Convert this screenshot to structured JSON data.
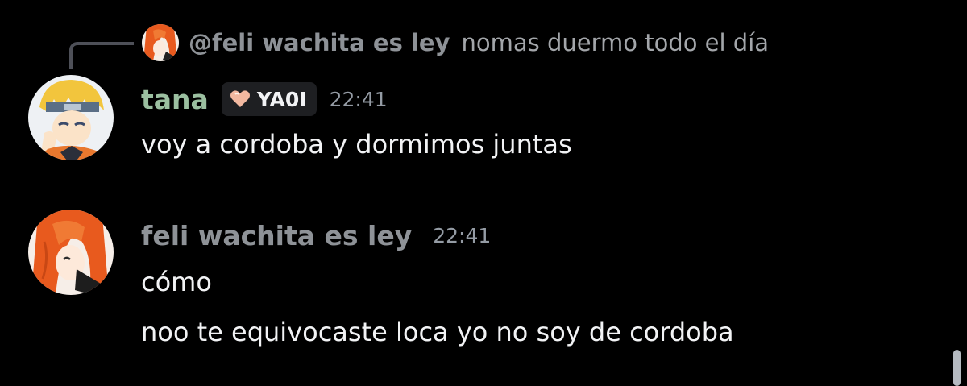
{
  "reply": {
    "author": "@feli wachita es ley",
    "text": "nomas duermo todo el día",
    "avatar_icon": "orange-haired-anime-avatar"
  },
  "messages": [
    {
      "author": "tana",
      "author_color": "#9bbfa0",
      "avatar_icon": "blond-ninja-avatar",
      "badge": {
        "icon": "heart-icon",
        "label": "YA0I",
        "icon_color": "#f2b8a0"
      },
      "timestamp": "22:41",
      "lines": [
        "voy a cordoba y dormimos juntas"
      ]
    },
    {
      "author": "feli wachita es ley",
      "author_color": "#8e9297",
      "avatar_icon": "orange-haired-anime-avatar",
      "timestamp": "22:41",
      "lines": [
        "cómo",
        "noo te equivocaste loca yo no soy de cordoba"
      ]
    }
  ],
  "colors": {
    "background": "#000000",
    "text": "#f2f3f5",
    "muted": "#949ba4",
    "reply_line": "#4e5058",
    "badge_bg": "#1e1f22"
  }
}
